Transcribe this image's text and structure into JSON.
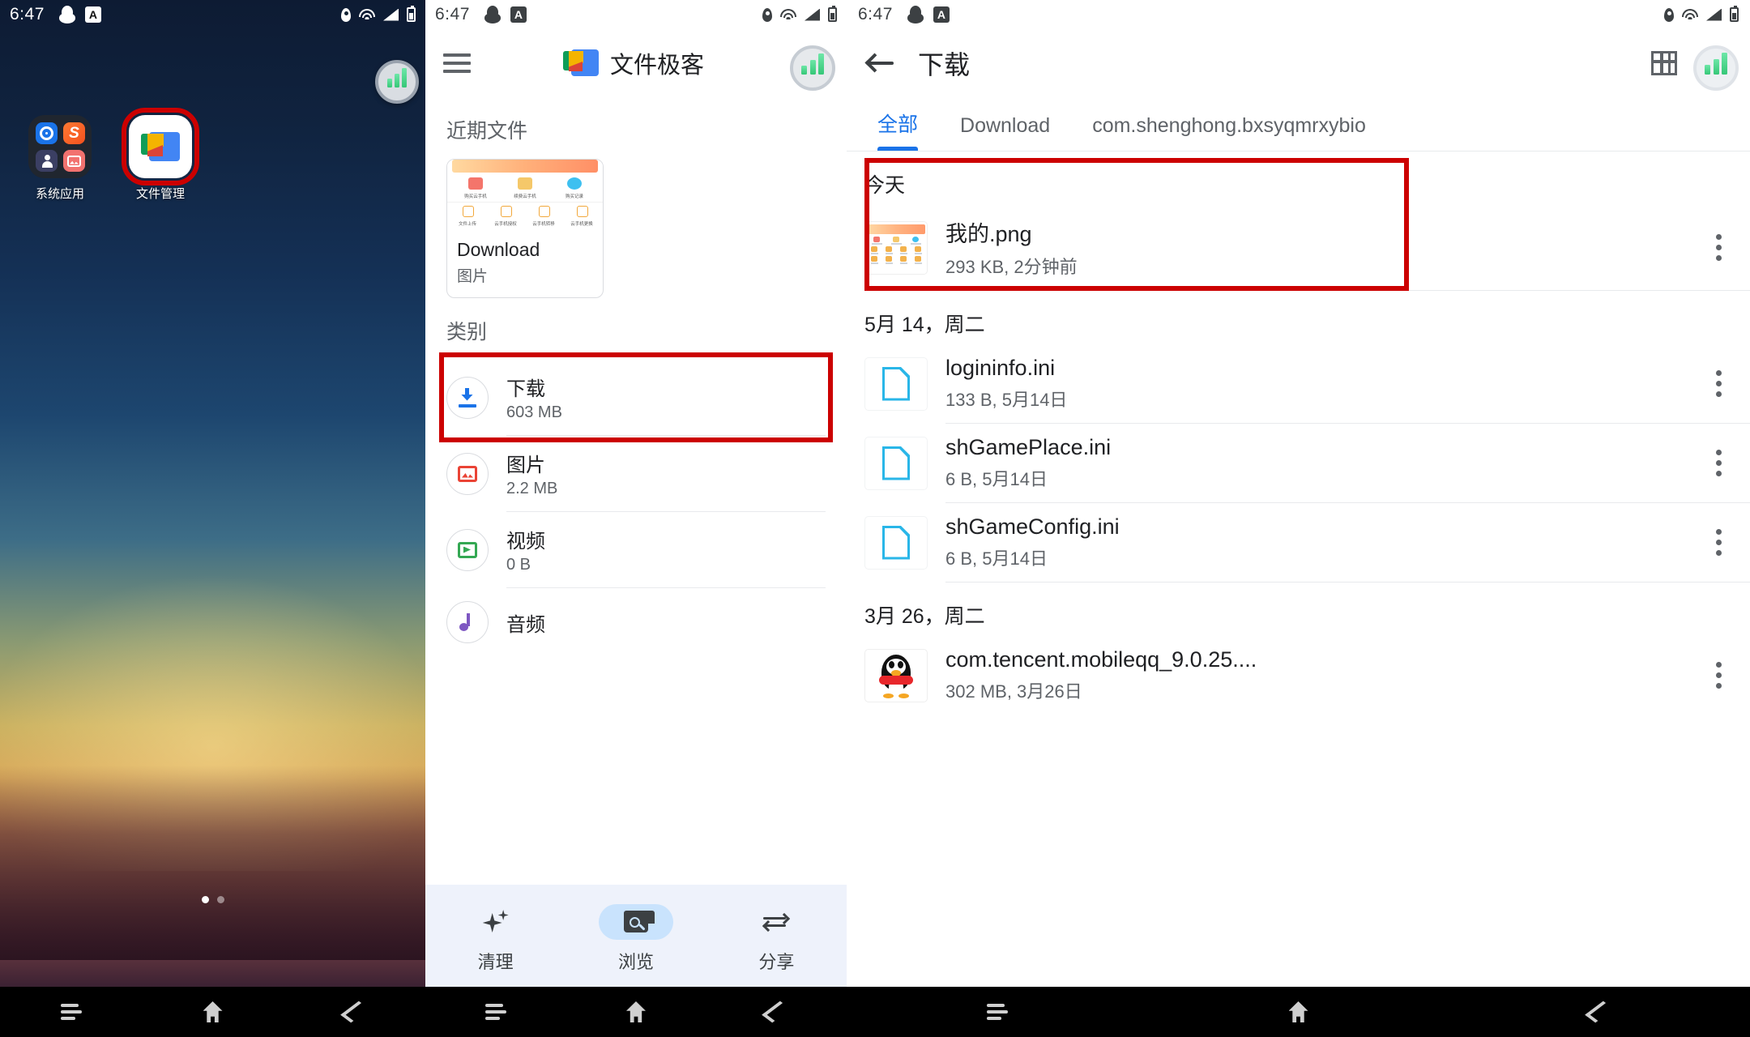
{
  "statusbar": {
    "time": "6:47"
  },
  "home": {
    "folder": {
      "label": "系统应用",
      "apps": [
        "settings-app",
        "sogou-app",
        "contacts-app",
        "gallery-app"
      ]
    },
    "files_app": {
      "label": "文件管理",
      "highlighted": true
    },
    "page_dots": {
      "count": 2,
      "active_index": 0
    },
    "highlight_color": "#cc0000"
  },
  "files_app": {
    "title": "文件极客",
    "menu_icon": "hamburger-menu-icon",
    "search_icon": "search-icon",
    "recent_section": {
      "title": "近期文件"
    },
    "recent_card": {
      "name": "Download",
      "subtitle": "图片"
    },
    "categories_section": {
      "title": "类别"
    },
    "categories": [
      {
        "name": "下载",
        "size": "603 MB",
        "icon": "download-icon",
        "highlighted": true
      },
      {
        "name": "图片",
        "size": "2.2 MB",
        "icon": "image-icon",
        "highlighted": false
      },
      {
        "name": "视频",
        "size": "0 B",
        "icon": "video-icon",
        "highlighted": false
      },
      {
        "name": "音频",
        "size": "",
        "icon": "audio-icon",
        "highlighted": false
      }
    ],
    "bottom_nav": [
      {
        "label": "清理",
        "icon": "sparkle-icon",
        "active": false
      },
      {
        "label": "浏览",
        "icon": "browse-folder-icon",
        "active": true
      },
      {
        "label": "分享",
        "icon": "share-arrows-icon",
        "active": false
      }
    ],
    "thumbnail_grid": {
      "row1": [
        "购买云手机",
        "续费云手机",
        "购买记录"
      ],
      "row2": [
        "文件上传",
        "云手机授权",
        "云手机转移",
        "云手机更换"
      ]
    }
  },
  "download_view": {
    "title": "下载",
    "back_icon": "back-arrow-icon",
    "grid_icon": "grid-view-icon",
    "more_icon": "more-vertical-icon",
    "tabs": [
      {
        "label": "全部",
        "active": true
      },
      {
        "label": "Download",
        "active": false
      },
      {
        "label": "com.shenghong.bxsyqmrxybio",
        "active": false
      }
    ],
    "groups": [
      {
        "label": "今天",
        "highlighted": true,
        "files": [
          {
            "name": "我的.png",
            "meta": "293 KB, 2分钟前",
            "thumb": "image-screenshot-thumb"
          }
        ]
      },
      {
        "label": "5月 14，周二",
        "highlighted": false,
        "files": [
          {
            "name": "logininfo.ini",
            "meta": "133 B, 5月14日",
            "thumb": "document-icon"
          },
          {
            "name": "shGamePlace.ini",
            "meta": "6 B, 5月14日",
            "thumb": "document-icon"
          },
          {
            "name": "shGameConfig.ini",
            "meta": "6 B, 5月14日",
            "thumb": "document-icon"
          }
        ]
      },
      {
        "label": "3月 26，周二",
        "highlighted": false,
        "files": [
          {
            "name": "com.tencent.mobileqq_9.0.25....",
            "meta": "302 MB, 3月26日",
            "thumb": "qq-penguin-icon"
          }
        ]
      }
    ]
  },
  "navbar": {
    "recent": "recent-apps-icon",
    "home": "home-icon",
    "back": "back-icon"
  }
}
